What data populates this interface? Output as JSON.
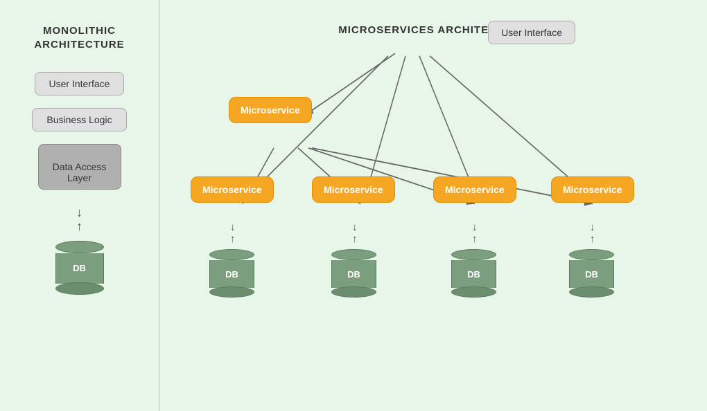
{
  "left": {
    "title": "MONOLITHIC\nARCHITECTURE",
    "boxes": [
      {
        "label": "User Interface",
        "style": "light"
      },
      {
        "label": "Business Logic",
        "style": "light"
      },
      {
        "label": "Data Access\nLayer",
        "style": "dark"
      }
    ],
    "db_label": "DB"
  },
  "right": {
    "title": "MICROSERVICES ARCHITECTURE",
    "user_interface_label": "User Interface",
    "microservice_labels": [
      "Microservice",
      "Microservice",
      "Microservice",
      "Microservice",
      "Microservice"
    ],
    "db_labels": [
      "DB",
      "DB",
      "DB",
      "DB"
    ]
  }
}
